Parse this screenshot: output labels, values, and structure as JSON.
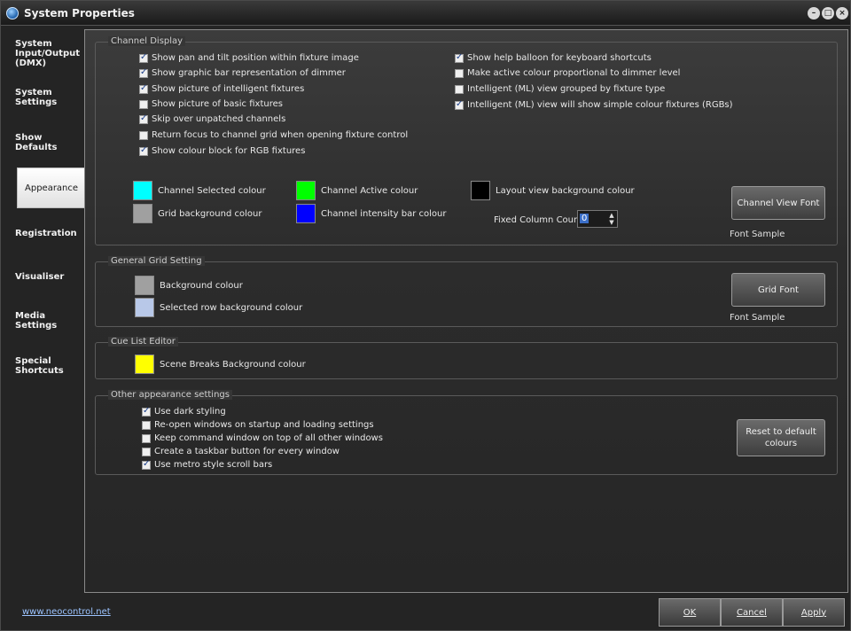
{
  "window": {
    "title": "System Properties"
  },
  "sidebar": {
    "items": [
      {
        "label": "System Input/Output (DMX)"
      },
      {
        "label": "System Settings"
      },
      {
        "label": "Show Defaults"
      },
      {
        "label": "Appearance"
      },
      {
        "label": "Registration"
      },
      {
        "label": "Visualiser"
      },
      {
        "label": "Media Settings"
      },
      {
        "label": "Special Shortcuts"
      }
    ]
  },
  "channel_display": {
    "title": "Channel Display",
    "options_left": [
      {
        "label": "Show pan and tilt position within fixture image",
        "checked": true
      },
      {
        "label": "Show graphic bar representation of dimmer",
        "checked": true
      },
      {
        "label": "Show picture of intelligent fixtures",
        "checked": true
      },
      {
        "label": "Show picture of basic fixtures",
        "checked": false
      },
      {
        "label": "Skip over unpatched channels",
        "checked": true
      },
      {
        "label": "Return focus to channel grid when opening fixture control",
        "checked": false
      },
      {
        "label": "Show colour block for RGB fixtures",
        "checked": true
      }
    ],
    "options_right": [
      {
        "label": "Show help balloon for keyboard shortcuts",
        "checked": true
      },
      {
        "label": "Make active colour proportional to dimmer level",
        "checked": false
      },
      {
        "label": "Intelligent (ML) view grouped by fixture type",
        "checked": false
      },
      {
        "label": "Intelligent (ML) view will show simple colour fixtures (RGBs)",
        "checked": true
      }
    ],
    "colours": {
      "channel_selected": {
        "label": "Channel Selected colour",
        "color": "#00ffff"
      },
      "channel_active": {
        "label": "Channel Active colour",
        "color": "#00ff00"
      },
      "layout_bg": {
        "label": "Layout view background colour",
        "color": "#000000"
      },
      "grid_bg": {
        "label": "Grid background colour",
        "color": "#a0a0a0"
      },
      "intensity_bar": {
        "label": "Channel intensity bar colour",
        "color": "#0000ff"
      }
    },
    "fixed_column_count": {
      "label": "Fixed Column Count",
      "value": "0"
    },
    "font_button": "Channel View Font",
    "font_sample": "Font Sample"
  },
  "general_grid": {
    "title": "General Grid Setting",
    "background": {
      "label": "Background colour",
      "color": "#a0a0a0"
    },
    "selected_row": {
      "label": "Selected row background colour",
      "color": "#b8c8e8"
    },
    "font_button": "Grid Font",
    "font_sample": "Font Sample"
  },
  "cue_list": {
    "title": "Cue List Editor",
    "scene_breaks": {
      "label": "Scene Breaks Background colour",
      "color": "#ffff00"
    }
  },
  "other": {
    "title": "Other appearance settings",
    "options": [
      {
        "label": "Use dark styling",
        "checked": true
      },
      {
        "label": "Re-open windows on startup and loading settings",
        "checked": false
      },
      {
        "label": "Keep command window on top of all other windows",
        "checked": false
      },
      {
        "label": "Create a taskbar button for every window",
        "checked": false
      },
      {
        "label": "Use metro style scroll bars",
        "checked": true
      }
    ],
    "reset_button": "Reset to default colours"
  },
  "footer": {
    "link": "www.neocontrol.net",
    "ok": "OK",
    "cancel": "Cancel",
    "apply": "Apply"
  }
}
